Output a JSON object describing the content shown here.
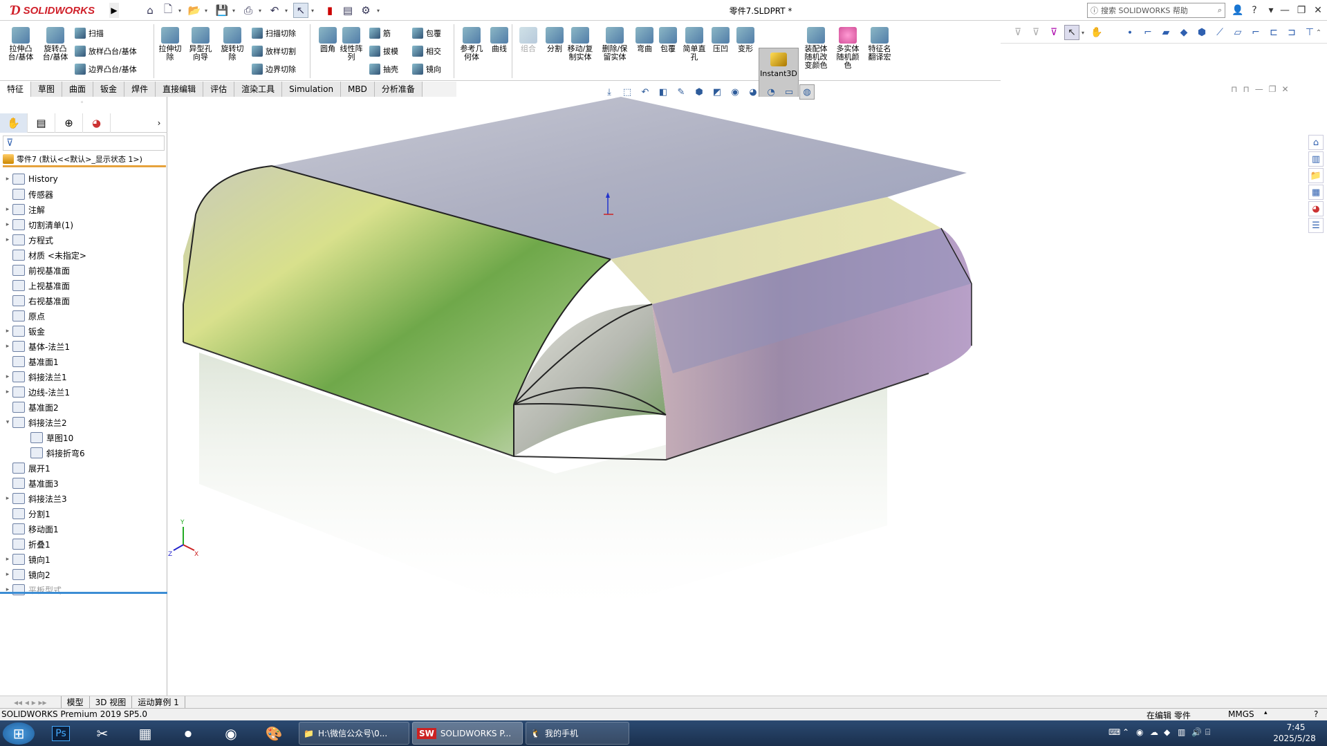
{
  "app": {
    "brand": "SOLIDWORKS",
    "document_title": "零件7.SLDPRT *",
    "help_search_placeholder": "搜索 SOLIDWORKS 帮助"
  },
  "ribbon": {
    "groups": [
      {
        "label": "拉伸凸\n台/基体"
      },
      {
        "label": "旋转凸\n台/基体"
      },
      {
        "label": "扫描"
      },
      {
        "label": "放样凸台/基体"
      },
      {
        "label": "边界凸台/基体"
      },
      {
        "label": "拉伸切\n除"
      },
      {
        "label": "异型孔\n向导"
      },
      {
        "label": "旋转切\n除"
      },
      {
        "label": "扫描切除"
      },
      {
        "label": "放样切割"
      },
      {
        "label": "边界切除"
      },
      {
        "label": "圆角"
      },
      {
        "label": "线性阵\n列"
      },
      {
        "label": "筋"
      },
      {
        "label": "拔模"
      },
      {
        "label": "抽壳"
      },
      {
        "label": "包覆"
      },
      {
        "label": "相交"
      },
      {
        "label": "镜向"
      },
      {
        "label": "参考几\n何体"
      },
      {
        "label": "曲线"
      },
      {
        "label": "组合"
      },
      {
        "label": "分割"
      },
      {
        "label": "移动/复\n制实体"
      },
      {
        "label": "删除/保\n留实体"
      },
      {
        "label": "弯曲"
      },
      {
        "label": "包覆"
      },
      {
        "label": "简单直\n孔"
      },
      {
        "label": "压凹"
      },
      {
        "label": "变形"
      },
      {
        "label": "Instant3D"
      },
      {
        "label": "装配体\n随机改\n变颜色"
      },
      {
        "label": "多实体\n随机颜\n色"
      },
      {
        "label": "特征名\n翻译宏"
      }
    ]
  },
  "tabs": [
    "特征",
    "草图",
    "曲面",
    "钣金",
    "焊件",
    "直接编辑",
    "评估",
    "渲染工具",
    "Simulation",
    "MBD",
    "分析准备"
  ],
  "feature_tree": {
    "root": "零件7 (默认<<默认>_显示状态 1>)",
    "nodes": [
      {
        "label": "History",
        "expand": "▸"
      },
      {
        "label": "传感器",
        "expand": ""
      },
      {
        "label": "注解",
        "expand": "▸"
      },
      {
        "label": "切割清单(1)",
        "expand": "▸"
      },
      {
        "label": "方程式",
        "expand": "▸"
      },
      {
        "label": "材质 <未指定>",
        "expand": ""
      },
      {
        "label": "前视基准面",
        "expand": ""
      },
      {
        "label": "上视基准面",
        "expand": ""
      },
      {
        "label": "右视基准面",
        "expand": ""
      },
      {
        "label": "原点",
        "expand": ""
      },
      {
        "label": "钣金",
        "expand": "▸"
      },
      {
        "label": "基体-法兰1",
        "expand": "▸"
      },
      {
        "label": "基准面1",
        "expand": ""
      },
      {
        "label": "斜接法兰1",
        "expand": "▸"
      },
      {
        "label": "边线-法兰1",
        "expand": "▸"
      },
      {
        "label": "基准面2",
        "expand": ""
      },
      {
        "label": "斜接法兰2",
        "expand": "▾"
      },
      {
        "label": "草图10",
        "expand": "",
        "indent": true
      },
      {
        "label": "斜接折弯6",
        "expand": "",
        "indent": true
      },
      {
        "label": "展开1",
        "expand": ""
      },
      {
        "label": "基准面3",
        "expand": ""
      },
      {
        "label": "斜接法兰3",
        "expand": "▸"
      },
      {
        "label": "分割1",
        "expand": ""
      },
      {
        "label": "移动面1",
        "expand": ""
      },
      {
        "label": "折叠1",
        "expand": ""
      },
      {
        "label": "镜向1",
        "expand": "▸"
      },
      {
        "label": "镜向2",
        "expand": "▸"
      },
      {
        "label": "平板型式",
        "expand": "▸",
        "dim": true
      }
    ]
  },
  "model_tabs": [
    "模型",
    "3D 视图",
    "运动算例 1"
  ],
  "status": {
    "product": "SOLIDWORKS Premium 2019 SP5.0",
    "editing": "在编辑 零件",
    "units": "MMGS"
  },
  "taskbar": {
    "items": [
      {
        "label": "H:\\微信公众号\\0..."
      },
      {
        "label": "SOLIDWORKS P..."
      },
      {
        "label": "我的手机"
      }
    ],
    "time": "7:45",
    "date": "2025/5/28"
  },
  "colors": {
    "accent": "#d0202a",
    "selection": "#3c8dd4",
    "root_underline": "#e6a23c"
  },
  "icons": {
    "axis": "triad-icon"
  }
}
